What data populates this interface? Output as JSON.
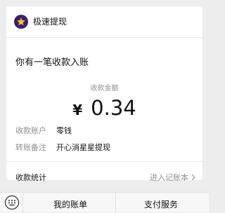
{
  "header": {
    "sender_name": "极速提现"
  },
  "message": {
    "title": "你有一笔收款入账"
  },
  "amount": {
    "label": "收款金额",
    "currency": "¥",
    "value": "0.34"
  },
  "details": [
    {
      "key": "收款账户",
      "value": "零钱"
    },
    {
      "key": "转账备注",
      "value": "开心消星星提现"
    }
  ],
  "stats": {
    "label": "收款统计",
    "link": "进入记账本"
  },
  "tabbar": {
    "tab1": "我的账单",
    "tab2": "支付服务"
  },
  "colors": {
    "logo_bg": "#3a1f6a",
    "logo_star": "#f7c531",
    "gray_text": "#8f8f8f"
  }
}
